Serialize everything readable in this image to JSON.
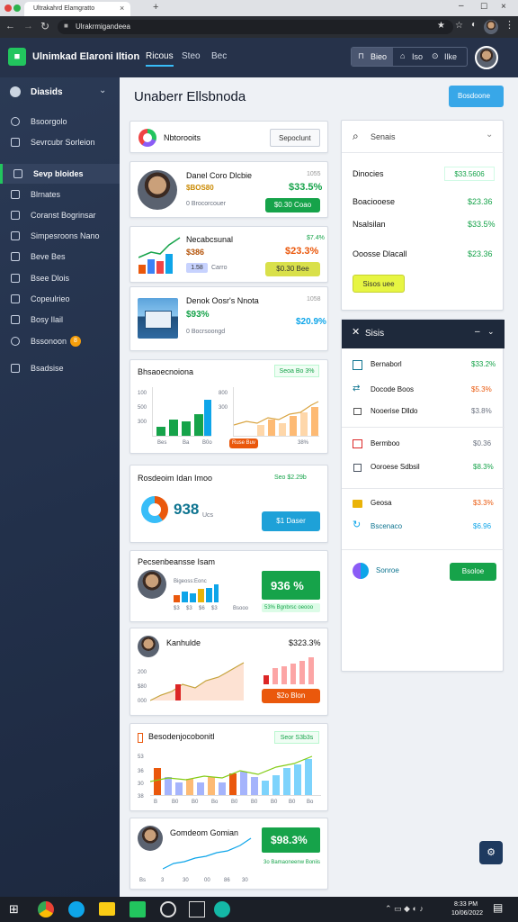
{
  "browser": {
    "tab_title": "Ultrakahrd Elamgratto",
    "url": "Ulrakrmigandeea",
    "colors": {
      "tabs_bg": "#dfe1e5",
      "bar_bg": "#2a2d33"
    }
  },
  "topnav": {
    "app_title": "Ulnimkad Elaroni Iltion",
    "links": [
      "Ricous",
      "Steo",
      "Bec"
    ],
    "actions": [
      "Bieo",
      "Iso",
      "Ilke"
    ]
  },
  "sidebar": {
    "header": "Diasids",
    "items": [
      {
        "label": "Bsoorgolo",
        "icon": "gear-icon"
      },
      {
        "label": "Sevrcubr Sorleion",
        "icon": "monitor-icon"
      },
      {
        "label": "Sevp bloides",
        "icon": "dashboard-icon",
        "active": true
      },
      {
        "label": "Blrnates",
        "icon": "list-icon"
      },
      {
        "label": "Coranst Bogrinsar",
        "icon": "table-icon"
      },
      {
        "label": "Simpesroons Nano",
        "icon": "calendar-icon"
      },
      {
        "label": "Beve Bes",
        "icon": "mail-icon"
      },
      {
        "label": "Bsee Dlois",
        "icon": "lock-icon"
      },
      {
        "label": "Copeulrieo",
        "icon": "users-icon"
      },
      {
        "label": "Bosy Ilail",
        "icon": "box-icon"
      },
      {
        "label": "Bssonoon",
        "icon": "globe-icon",
        "badge": "8"
      },
      {
        "label": "Bsadsise",
        "icon": "folder-icon"
      }
    ]
  },
  "page": {
    "title": "Unaberr Ellsbnoda",
    "primary_button": "Bosdoone"
  },
  "cards": {
    "header": {
      "title": "Nbtorooits",
      "button": "Sepoclunt"
    },
    "c1": {
      "name": "Danel Coro Dlcbie",
      "sub": "1055",
      "tag": "$BOS80",
      "value": "$33.5%",
      "detail": "0 Brocorcouer",
      "btn": "$0.30  Coao"
    },
    "c2": {
      "name": "Necabcsunal",
      "sub": "$386",
      "value": "$23.3%",
      "value2": "$7.4%",
      "tag": "1.58",
      "detail": "Carro",
      "btn": "$0.30  Bee"
    },
    "c3": {
      "name": "Denok Oosr's Nnota",
      "sub": "1058",
      "value": "$93%",
      "detail": "0 Bocrsoongd",
      "value2": "$20.9%"
    },
    "c4": {
      "title": "Bhsaoecnoiona",
      "badge": "Seoa Bo 3%",
      "chip": "Ruse Buv",
      "y_ticks": [
        "100",
        "500",
        "300",
        "800",
        "300"
      ],
      "x_ticks": [
        "Bes",
        "Ba",
        "B0o",
        "38%"
      ]
    },
    "c5": {
      "title": "Rosdeoim Idan Imoo",
      "badge": "Seo $2.29b",
      "value": "938",
      "sub": "Ucs",
      "btn": "$1  Daser"
    },
    "c6": {
      "title": "Pecsenbeansse Isam",
      "name": "Bigeoss:Eonc",
      "value": "936 %",
      "sub": "$3%",
      "caption": "53%  Bgnbrsc oeooo",
      "x_ticks": [
        "$3",
        "$3",
        "$6",
        "$3",
        "30",
        "Bsooo"
      ]
    },
    "c7": {
      "name": "Kanhulde",
      "value": "$323.3%",
      "y_ticks": [
        "200",
        "$80",
        "000"
      ],
      "chip": "$2o Blon"
    },
    "c8": {
      "title": "Besodenjocobonitl",
      "badge": "Seor S3b3s",
      "y_ticks": [
        "53",
        "36",
        "30",
        "38"
      ],
      "x_ticks": [
        "B",
        "B0",
        "B0",
        "Bo",
        "B0",
        "B0",
        "B0",
        "B0",
        "Bo"
      ]
    },
    "c9": {
      "name": "Gomdeom Gomian",
      "value": "$98.3%",
      "caption": "3o  Bamaoneenw Boniis",
      "x_ticks": [
        "Bs",
        "3",
        "30",
        "00",
        "86",
        "30"
      ]
    }
  },
  "right": {
    "search": {
      "placeholder": "Senais"
    },
    "summary": [
      {
        "label": "Dinocies",
        "value": "$33.5606"
      },
      {
        "label": "Boaciooese",
        "value": "$23.36"
      },
      {
        "label": "Nsalsilan",
        "value": "$33.5%"
      },
      {
        "label": "Ooosse Dlacall",
        "value": "$23.36"
      }
    ],
    "summary_btn": "Sisos uee",
    "panel": {
      "title": "Sisis",
      "rows": [
        {
          "label": "Bernaborl",
          "value": "$33.2%",
          "color": "green"
        },
        {
          "label": "Docode Boos",
          "value": "$5.3%",
          "color": "orange"
        },
        {
          "label": "Nooerise Dlldo",
          "value": "$3.8%",
          "color": "grey"
        },
        {
          "label": "Bermboo",
          "value": "$0.36",
          "color": "grey"
        },
        {
          "label": "Ooroese Sdbsil",
          "value": "$8.3%",
          "color": "green"
        },
        {
          "label": "Geosa",
          "value": "$3.3%",
          "color": "orange"
        },
        {
          "label": "Bscenaco",
          "value": "$6.96",
          "color": "blue"
        }
      ],
      "footer_label": "Sonroe",
      "footer_btn": "Bsoloe"
    }
  },
  "taskbar": {
    "time": "8:33 PM",
    "date": "10/06/2022"
  }
}
